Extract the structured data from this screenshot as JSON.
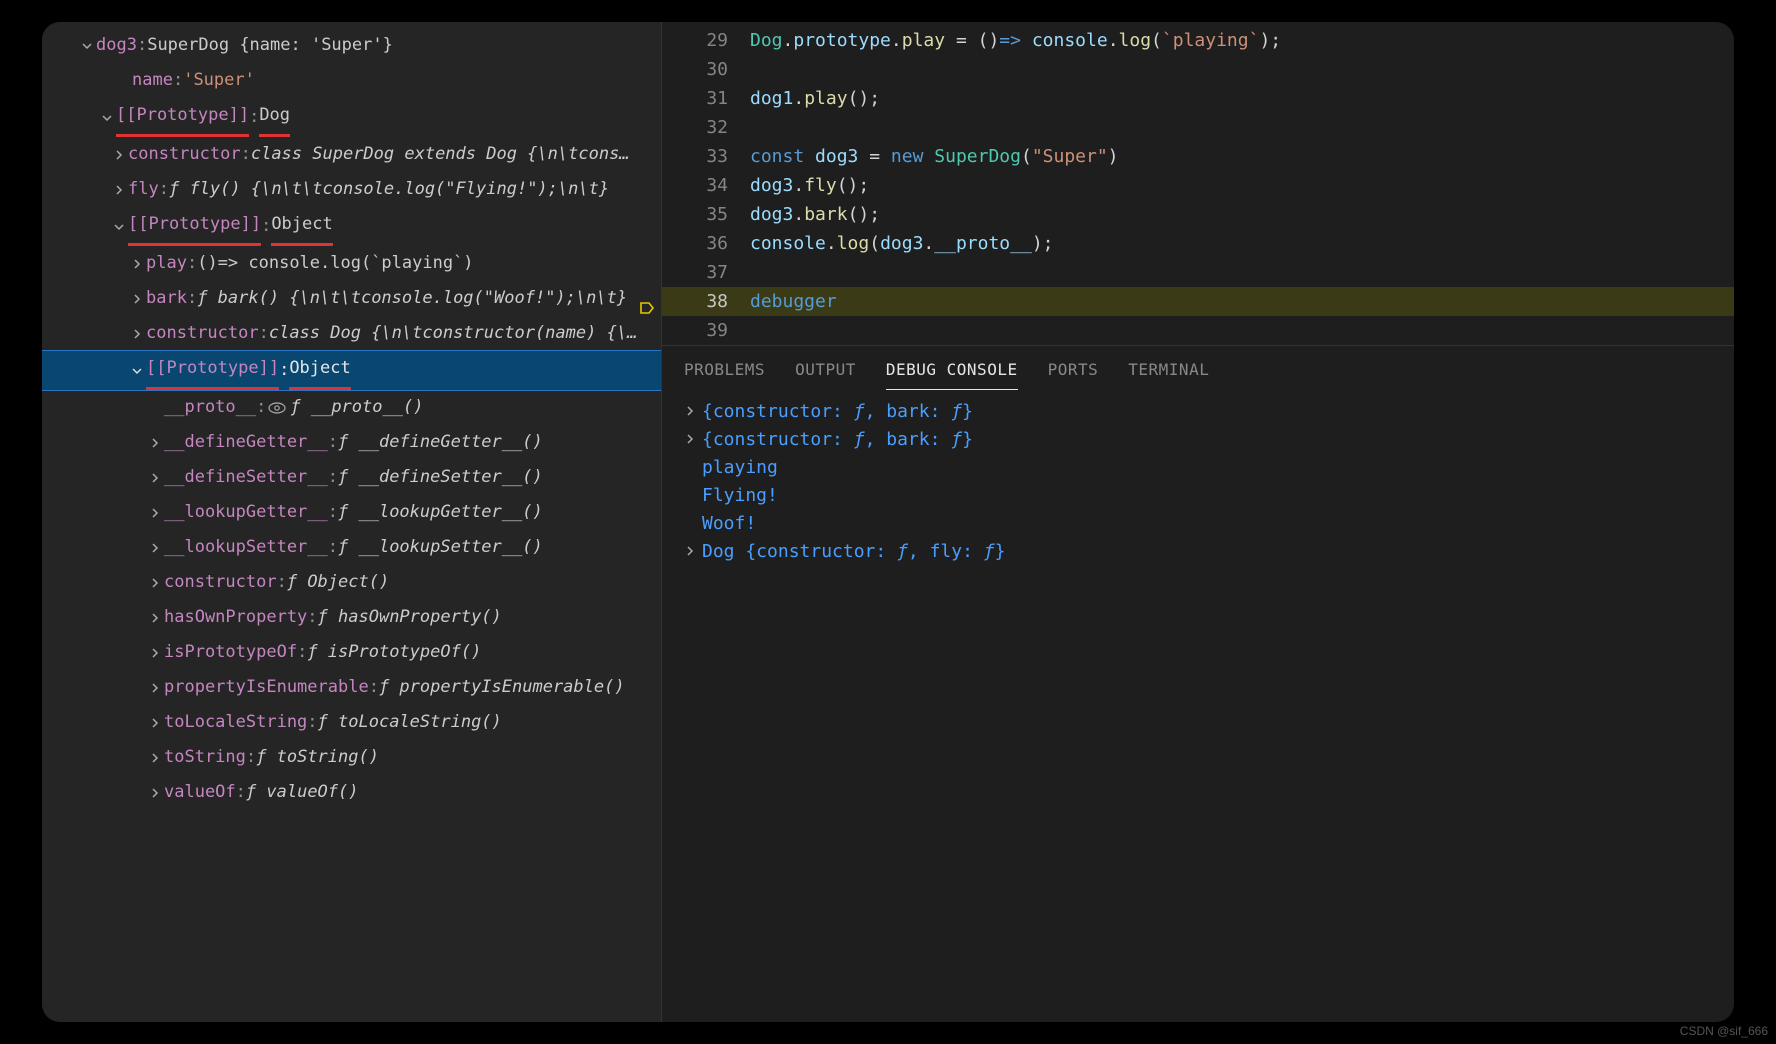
{
  "left": {
    "root": {
      "key": "dog3",
      "summary": "SuperDog {name: 'Super'}"
    },
    "name_row": {
      "key": "name",
      "value": "'Super'"
    },
    "proto1": {
      "label": "[[Prototype]]",
      "value": "Dog"
    },
    "p1rows": [
      {
        "key": "constructor",
        "value": "class SuperDog extends Dog {\\n\\tcons…"
      },
      {
        "key": "fly",
        "value": "ƒ fly() {\\n\\t\\tconsole.log(\"Flying!\");\\n\\t}"
      }
    ],
    "proto2": {
      "label": "[[Prototype]]",
      "value": "Object"
    },
    "p2rows": [
      {
        "key": "play",
        "value": "()=> console.log(`playing`)"
      },
      {
        "key": "bark",
        "value": "ƒ bark() {\\n\\t\\tconsole.log(\"Woof!\");\\n\\t}"
      },
      {
        "key": "constructor",
        "value": "class Dog {\\n\\tconstructor(name) {\\…"
      }
    ],
    "proto3": {
      "label": "[[Prototype]]",
      "value": "Object"
    },
    "proto_accessor": {
      "key": "__proto__",
      "value": "ƒ __proto__()"
    },
    "p3rows": [
      {
        "key": "__defineGetter__",
        "value": "ƒ __defineGetter__()"
      },
      {
        "key": "__defineSetter__",
        "value": "ƒ __defineSetter__()"
      },
      {
        "key": "__lookupGetter__",
        "value": "ƒ __lookupGetter__()"
      },
      {
        "key": "__lookupSetter__",
        "value": "ƒ __lookupSetter__()"
      },
      {
        "key": "constructor",
        "value": "ƒ Object()"
      },
      {
        "key": "hasOwnProperty",
        "value": "ƒ hasOwnProperty()"
      },
      {
        "key": "isPrototypeOf",
        "value": "ƒ isPrototypeOf()"
      },
      {
        "key": "propertyIsEnumerable",
        "value": "ƒ propertyIsEnumerable()"
      },
      {
        "key": "toLocaleString",
        "value": "ƒ toLocaleString()"
      },
      {
        "key": "toString",
        "value": "ƒ toString()"
      },
      {
        "key": "valueOf",
        "value": "ƒ valueOf()"
      }
    ]
  },
  "editor": {
    "lines": [
      {
        "n": "29",
        "tokens": [
          [
            "Dog",
            "cls"
          ],
          [
            ".",
            "punc"
          ],
          [
            "prototype",
            "prop"
          ],
          [
            ".",
            "punc"
          ],
          [
            "play",
            "func"
          ],
          [
            " = ()",
            "plain"
          ],
          [
            "=>",
            "kw"
          ],
          [
            " ",
            "plain"
          ],
          [
            "console",
            "var"
          ],
          [
            ".",
            "punc"
          ],
          [
            "log",
            "func"
          ],
          [
            "(",
            "punc"
          ],
          [
            "`playing`",
            "str"
          ],
          [
            ");",
            "punc"
          ]
        ]
      },
      {
        "n": "30",
        "tokens": []
      },
      {
        "n": "31",
        "tokens": [
          [
            "dog1",
            "var"
          ],
          [
            ".",
            "punc"
          ],
          [
            "play",
            "func"
          ],
          [
            "();",
            "punc"
          ]
        ]
      },
      {
        "n": "32",
        "tokens": []
      },
      {
        "n": "33",
        "tokens": [
          [
            "const ",
            "kw"
          ],
          [
            "dog3",
            "var"
          ],
          [
            " = ",
            "plain"
          ],
          [
            "new ",
            "new"
          ],
          [
            "SuperDog",
            "cls"
          ],
          [
            "(",
            "punc"
          ],
          [
            "\"Super\"",
            "str"
          ],
          [
            ")",
            "punc"
          ]
        ]
      },
      {
        "n": "34",
        "tokens": [
          [
            "dog3",
            "var"
          ],
          [
            ".",
            "punc"
          ],
          [
            "fly",
            "func"
          ],
          [
            "();",
            "punc"
          ]
        ]
      },
      {
        "n": "35",
        "tokens": [
          [
            "dog3",
            "var"
          ],
          [
            ".",
            "punc"
          ],
          [
            "bark",
            "func"
          ],
          [
            "();",
            "punc"
          ]
        ]
      },
      {
        "n": "36",
        "tokens": [
          [
            "console",
            "var"
          ],
          [
            ".",
            "punc"
          ],
          [
            "log",
            "func"
          ],
          [
            "(",
            "punc"
          ],
          [
            "dog3",
            "var"
          ],
          [
            ".",
            "punc"
          ],
          [
            "__proto__",
            "prop"
          ],
          [
            ");",
            "punc"
          ]
        ]
      },
      {
        "n": "37",
        "tokens": []
      },
      {
        "n": "38",
        "tokens": [
          [
            "debugger",
            "dbg"
          ]
        ],
        "hl": true,
        "bp": true
      },
      {
        "n": "39",
        "tokens": []
      }
    ]
  },
  "tabs": {
    "items": [
      "PROBLEMS",
      "OUTPUT",
      "DEBUG CONSOLE",
      "PORTS",
      "TERMINAL"
    ],
    "active": 2
  },
  "console": {
    "lines": [
      {
        "chev": true,
        "parts": [
          [
            "{constructor: ",
            "blue"
          ],
          [
            "ƒ",
            "blue italic"
          ],
          [
            ", bark: ",
            "blue"
          ],
          [
            "ƒ",
            "blue italic"
          ],
          [
            "}",
            "blue"
          ]
        ]
      },
      {
        "chev": true,
        "parts": [
          [
            "{constructor: ",
            "blue"
          ],
          [
            "ƒ",
            "blue italic"
          ],
          [
            ", bark: ",
            "blue"
          ],
          [
            "ƒ",
            "blue italic"
          ],
          [
            "}",
            "blue"
          ]
        ]
      },
      {
        "chev": false,
        "parts": [
          [
            "playing",
            "blue"
          ]
        ]
      },
      {
        "chev": false,
        "parts": [
          [
            "Flying!",
            "blue"
          ]
        ]
      },
      {
        "chev": false,
        "parts": [
          [
            "Woof!",
            "blue"
          ]
        ]
      },
      {
        "chev": true,
        "parts": [
          [
            "Dog {constructor: ",
            "blue"
          ],
          [
            "ƒ",
            "blue italic"
          ],
          [
            ", fly: ",
            "blue"
          ],
          [
            "ƒ",
            "blue italic"
          ],
          [
            "}",
            "blue"
          ]
        ]
      }
    ]
  },
  "watermark": "CSDN @sif_666"
}
